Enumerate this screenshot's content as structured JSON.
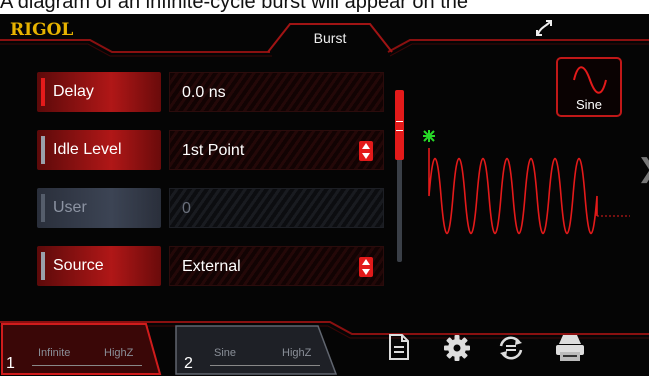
{
  "caption": "A diagram of an infinite-cycle burst will appear on the",
  "header": {
    "logo": "RIGOL",
    "title": "Burst",
    "usb_icon": "usb-icon"
  },
  "params": [
    {
      "label": "Delay",
      "value": "0.0 ns",
      "state": "active",
      "control": "text"
    },
    {
      "label": "Idle Level",
      "value": "1st Point",
      "state": "normal",
      "control": "dropdown"
    },
    {
      "label": "User",
      "value": "0",
      "state": "disabled",
      "control": "text"
    },
    {
      "label": "Source",
      "value": "External",
      "state": "normal",
      "control": "dropdown"
    }
  ],
  "waveform_button": {
    "label": "Sine",
    "icon": "sine-wave-icon"
  },
  "channels": [
    {
      "number": "1",
      "mode": "Infinite",
      "impedance": "HighZ"
    },
    {
      "number": "2",
      "mode": "Sine",
      "impedance": "HighZ"
    }
  ],
  "toolbar": [
    "document-icon",
    "gear-icon",
    "sync-icon",
    "printer-icon"
  ],
  "colors": {
    "accent": "#e31a1a",
    "logo": "#e7b300",
    "trigger_marker": "#27d827",
    "background": "#050505"
  }
}
